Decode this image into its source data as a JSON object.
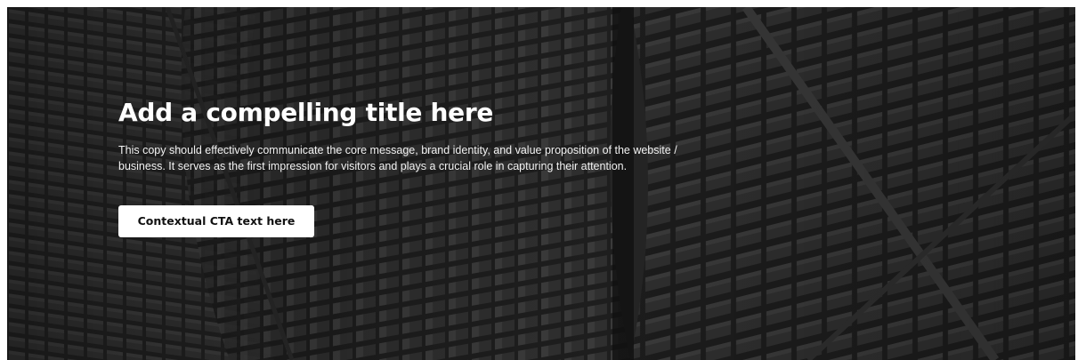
{
  "hero": {
    "title": "Add a compelling title here",
    "copy": "This copy should effectively communicate the core message, brand identity, and value proposition of the website / business. It serves as the first impression for visitors and plays a crucial role in capturing their attention.",
    "cta_label": "Contextual CTA text here",
    "background": "dark-building-facade-photo"
  },
  "colors": {
    "title": "#ffffff",
    "copy": "#f2f2f2",
    "cta_background": "#ffffff",
    "cta_text": "#111111",
    "backdrop": "#161616"
  }
}
